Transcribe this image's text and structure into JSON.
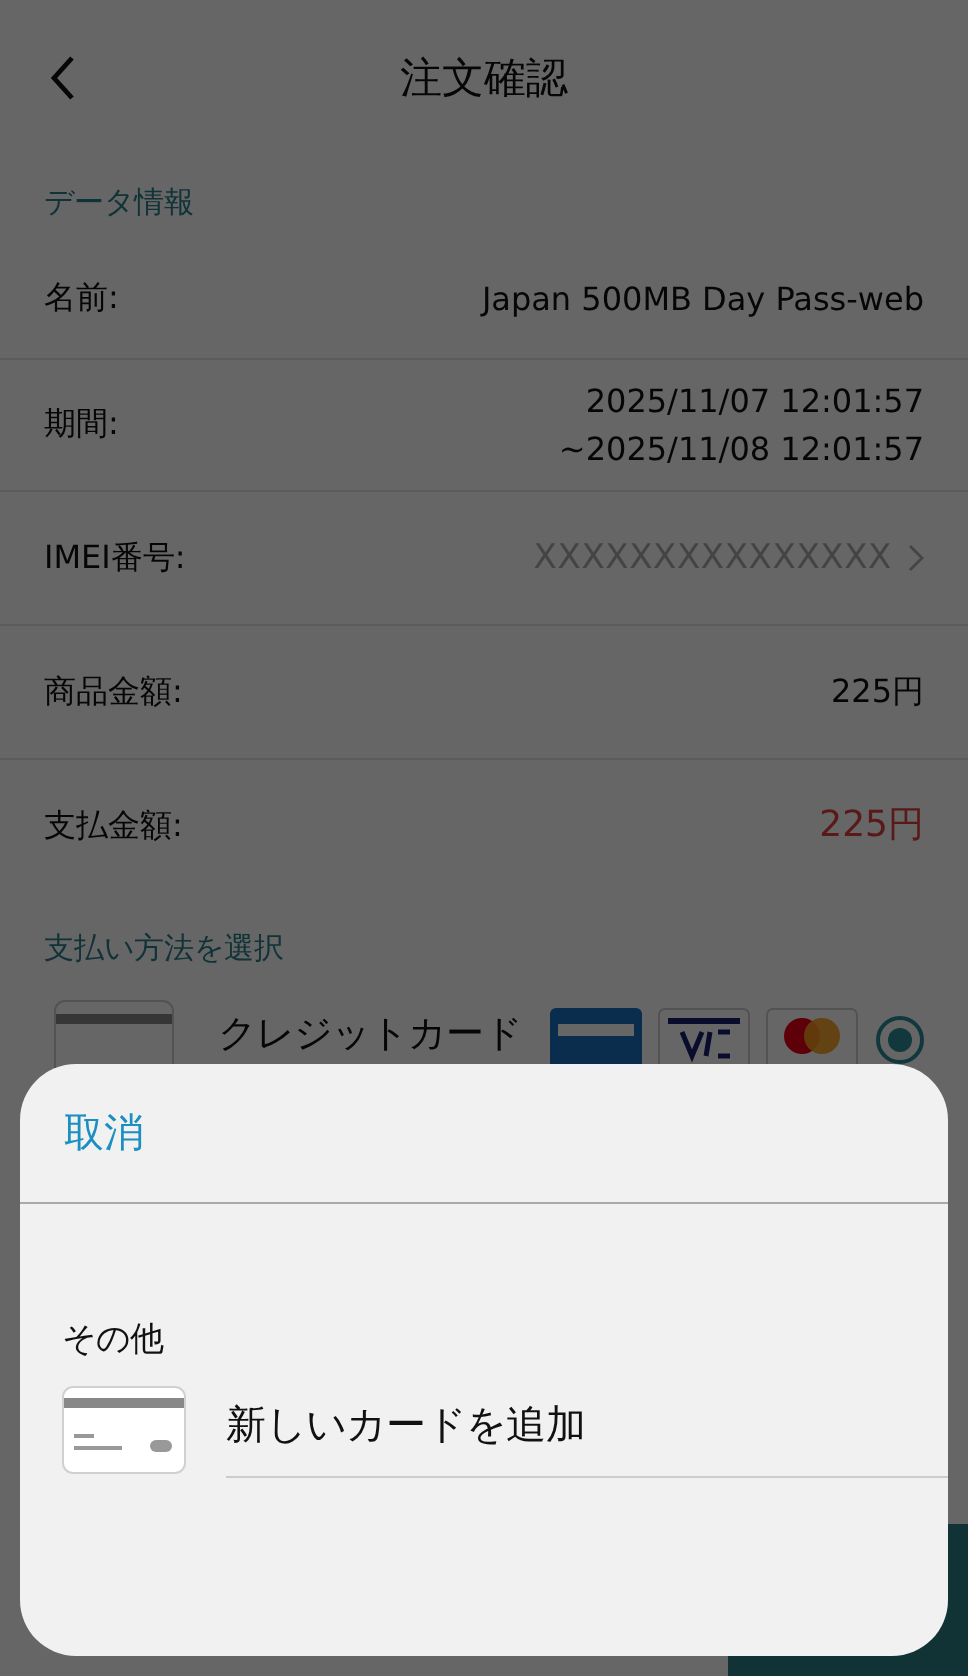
{
  "header": {
    "title": "注文確認"
  },
  "data_section": {
    "heading": "データ情報",
    "rows": [
      {
        "label": "名前:",
        "kind": "plain",
        "lines": [
          "Japan 500MB Day Pass-web"
        ]
      },
      {
        "label": "期間:",
        "kind": "plain",
        "lines": [
          "2025/11/07 12:01:57",
          "~2025/11/08 12:01:57"
        ]
      },
      {
        "label": "IMEI番号:",
        "kind": "link",
        "lines": [
          "XXXXXXXXXXXXXXX"
        ]
      },
      {
        "label": "商品金額:",
        "kind": "plain",
        "lines": [
          "225円"
        ]
      },
      {
        "label": "支払金額:",
        "kind": "alert",
        "lines": [
          "225円"
        ]
      }
    ]
  },
  "payment_section": {
    "heading": "支払い方法を選択",
    "methods": [
      {
        "label": "クレジットカード",
        "selected": true
      }
    ]
  },
  "sheet": {
    "cancel": "取消",
    "group_label": "その他",
    "option": "新しいカードを追加"
  }
}
